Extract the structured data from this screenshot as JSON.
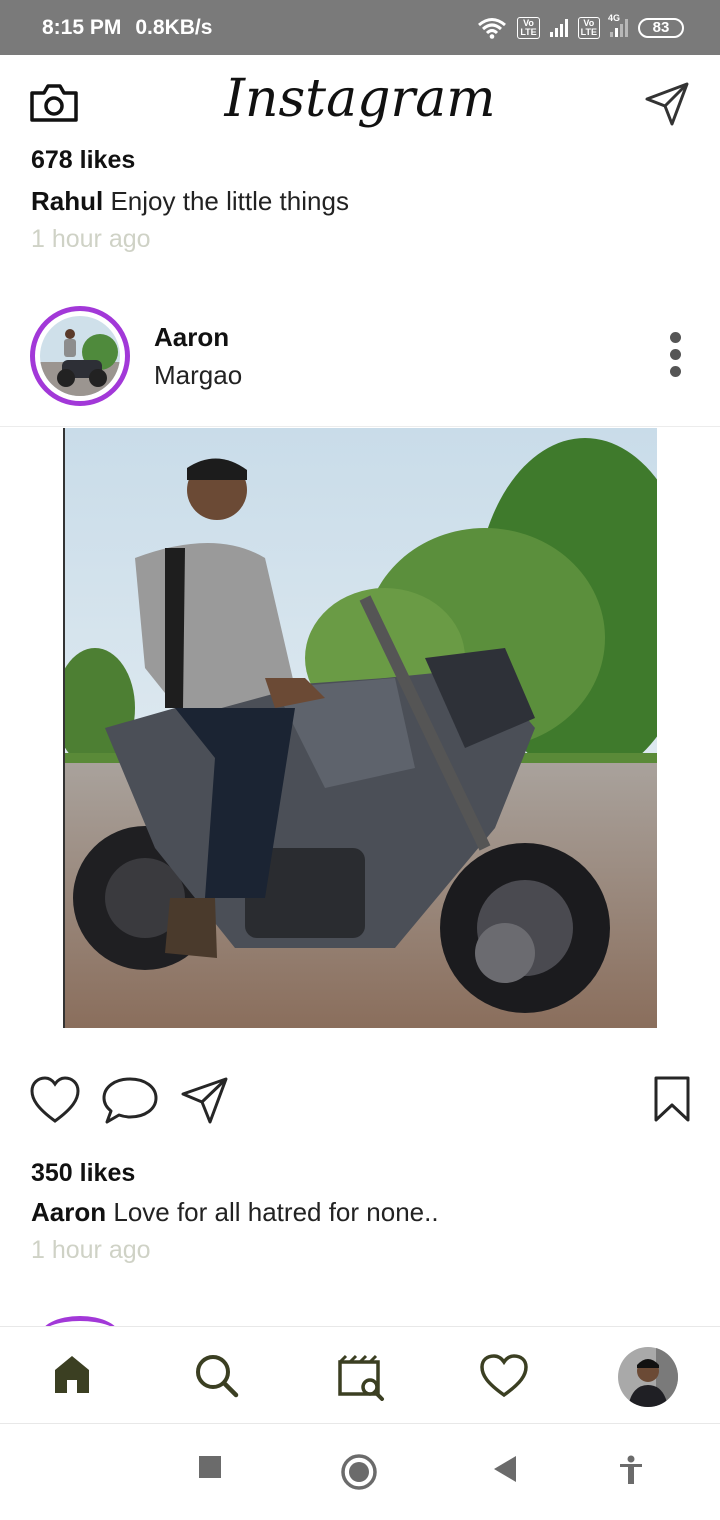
{
  "status_bar": {
    "time": "8:15 PM",
    "speed": "0.8KB/s",
    "volte_label": "Vo\nLTE",
    "network_4g": "4G",
    "battery": "83"
  },
  "header": {
    "logo_text": "Instagram"
  },
  "previous_post": {
    "likes": "678 likes",
    "username": "Rahul",
    "caption": "Enjoy the little things",
    "time": "1 hour ago"
  },
  "post": {
    "username": "Aaron",
    "location": "Margao",
    "likes": "350 likes",
    "caption_user": "Aaron",
    "caption": "Love for all hatred for none..",
    "time": "1 hour ago"
  },
  "icons": {
    "camera": "camera-icon",
    "direct": "paper-plane-icon",
    "more": "more-vertical-icon",
    "like": "heart-icon",
    "comment": "comment-icon",
    "share": "paper-plane-icon",
    "save": "bookmark-icon",
    "home": "home-icon",
    "search": "search-icon",
    "reels": "reels-search-icon",
    "activity": "heart-icon",
    "profile": "profile-avatar",
    "sys_recents": "square-icon",
    "sys_home": "circle-icon",
    "sys_back": "triangle-back-icon",
    "sys_accessibility": "accessibility-icon"
  },
  "colors": {
    "story_ring": "#a238d8",
    "nav_icon": "#3b3f22",
    "timestamp": "#cfd2c6",
    "status_bar_bg": "#7a7a7a"
  }
}
